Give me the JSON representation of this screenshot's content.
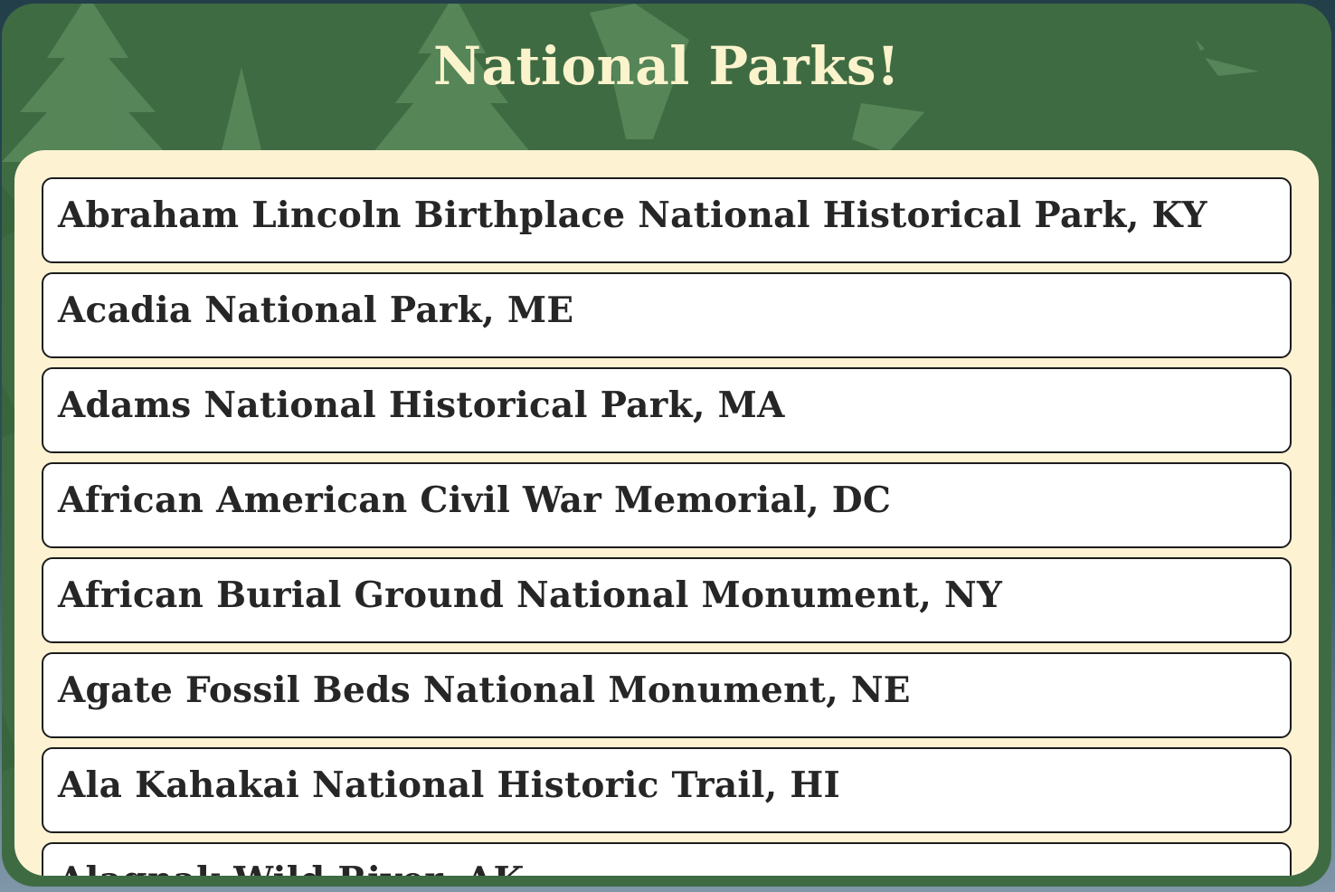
{
  "page": {
    "title": "National Parks!"
  },
  "colors": {
    "page_background": "#1f3a44",
    "window_background": "#3f6b43",
    "tree_silhouette": "#5a8a5c",
    "title_text": "#fbf3cc",
    "panel_background": "#fdf3d3",
    "item_background": "#ffffff",
    "item_border": "#1c1c1c",
    "item_text": "#262626"
  },
  "background_art": "evergreen-trees-silhouette",
  "parks": [
    {
      "label": "Abraham Lincoln Birthplace National Historical Park, KY"
    },
    {
      "label": "Acadia National Park, ME"
    },
    {
      "label": "Adams National Historical Park, MA"
    },
    {
      "label": "African American Civil War Memorial, DC"
    },
    {
      "label": "African Burial Ground National Monument, NY"
    },
    {
      "label": "Agate Fossil Beds National Monument, NE"
    },
    {
      "label": "Ala Kahakai National Historic Trail, HI"
    },
    {
      "label": "Alagnak Wild River, AK"
    }
  ]
}
